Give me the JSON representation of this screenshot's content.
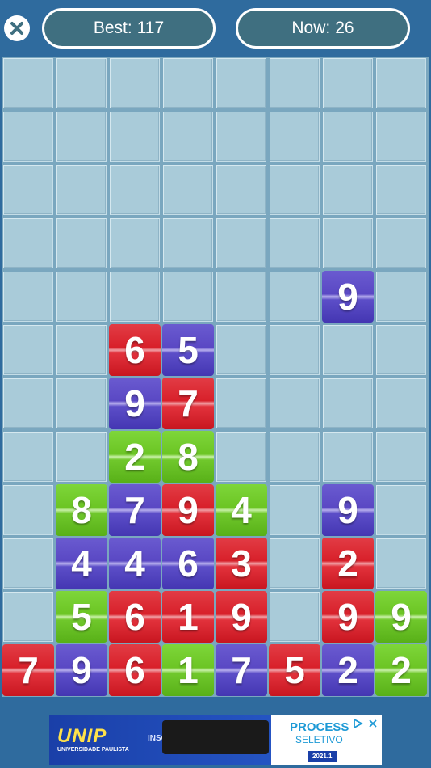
{
  "header": {
    "close_icon": "close-icon",
    "best_label": "Best:",
    "best_value": "117",
    "now_label": "Now:",
    "now_value": "26"
  },
  "board": {
    "columns": 8,
    "rows": 12,
    "tiles": [
      {
        "row": 4,
        "col": 6,
        "value": "9",
        "color": "blue"
      },
      {
        "row": 5,
        "col": 2,
        "value": "6",
        "color": "red"
      },
      {
        "row": 5,
        "col": 3,
        "value": "5",
        "color": "blue"
      },
      {
        "row": 6,
        "col": 2,
        "value": "9",
        "color": "blue"
      },
      {
        "row": 6,
        "col": 3,
        "value": "7",
        "color": "red"
      },
      {
        "row": 7,
        "col": 2,
        "value": "2",
        "color": "green"
      },
      {
        "row": 7,
        "col": 3,
        "value": "8",
        "color": "green"
      },
      {
        "row": 8,
        "col": 1,
        "value": "8",
        "color": "green"
      },
      {
        "row": 8,
        "col": 2,
        "value": "7",
        "color": "blue"
      },
      {
        "row": 8,
        "col": 3,
        "value": "9",
        "color": "red"
      },
      {
        "row": 8,
        "col": 4,
        "value": "4",
        "color": "green"
      },
      {
        "row": 8,
        "col": 6,
        "value": "9",
        "color": "blue"
      },
      {
        "row": 9,
        "col": 1,
        "value": "4",
        "color": "blue"
      },
      {
        "row": 9,
        "col": 2,
        "value": "4",
        "color": "blue"
      },
      {
        "row": 9,
        "col": 3,
        "value": "6",
        "color": "blue"
      },
      {
        "row": 9,
        "col": 4,
        "value": "3",
        "color": "red"
      },
      {
        "row": 9,
        "col": 6,
        "value": "2",
        "color": "red"
      },
      {
        "row": 10,
        "col": 1,
        "value": "5",
        "color": "green"
      },
      {
        "row": 10,
        "col": 2,
        "value": "6",
        "color": "red"
      },
      {
        "row": 10,
        "col": 3,
        "value": "1",
        "color": "red"
      },
      {
        "row": 10,
        "col": 4,
        "value": "9",
        "color": "red"
      },
      {
        "row": 10,
        "col": 6,
        "value": "9",
        "color": "red"
      },
      {
        "row": 10,
        "col": 7,
        "value": "9",
        "color": "green"
      },
      {
        "row": 11,
        "col": 0,
        "value": "7",
        "color": "red"
      },
      {
        "row": 11,
        "col": 1,
        "value": "9",
        "color": "blue"
      },
      {
        "row": 11,
        "col": 2,
        "value": "6",
        "color": "red"
      },
      {
        "row": 11,
        "col": 3,
        "value": "1",
        "color": "green"
      },
      {
        "row": 11,
        "col": 4,
        "value": "7",
        "color": "blue"
      },
      {
        "row": 11,
        "col": 5,
        "value": "5",
        "color": "red"
      },
      {
        "row": 11,
        "col": 6,
        "value": "2",
        "color": "blue"
      },
      {
        "row": 11,
        "col": 7,
        "value": "2",
        "color": "green"
      }
    ]
  },
  "ad": {
    "logo": "UNIP",
    "logo_sub": "UNIVERSIDADE PAULISTA",
    "ins_text": "INSC",
    "title": "PROCESSO",
    "subtitle": "SELETIVO",
    "year": "2021.1",
    "adchoices_icon": "adchoices-icon",
    "close_icon": "ad-close-icon"
  },
  "colors": {
    "background": "#2f6b9e",
    "pill": "#3f6f80",
    "red_tile": "#d8202a",
    "blue_tile": "#5a48c4",
    "green_tile": "#6cc524"
  }
}
